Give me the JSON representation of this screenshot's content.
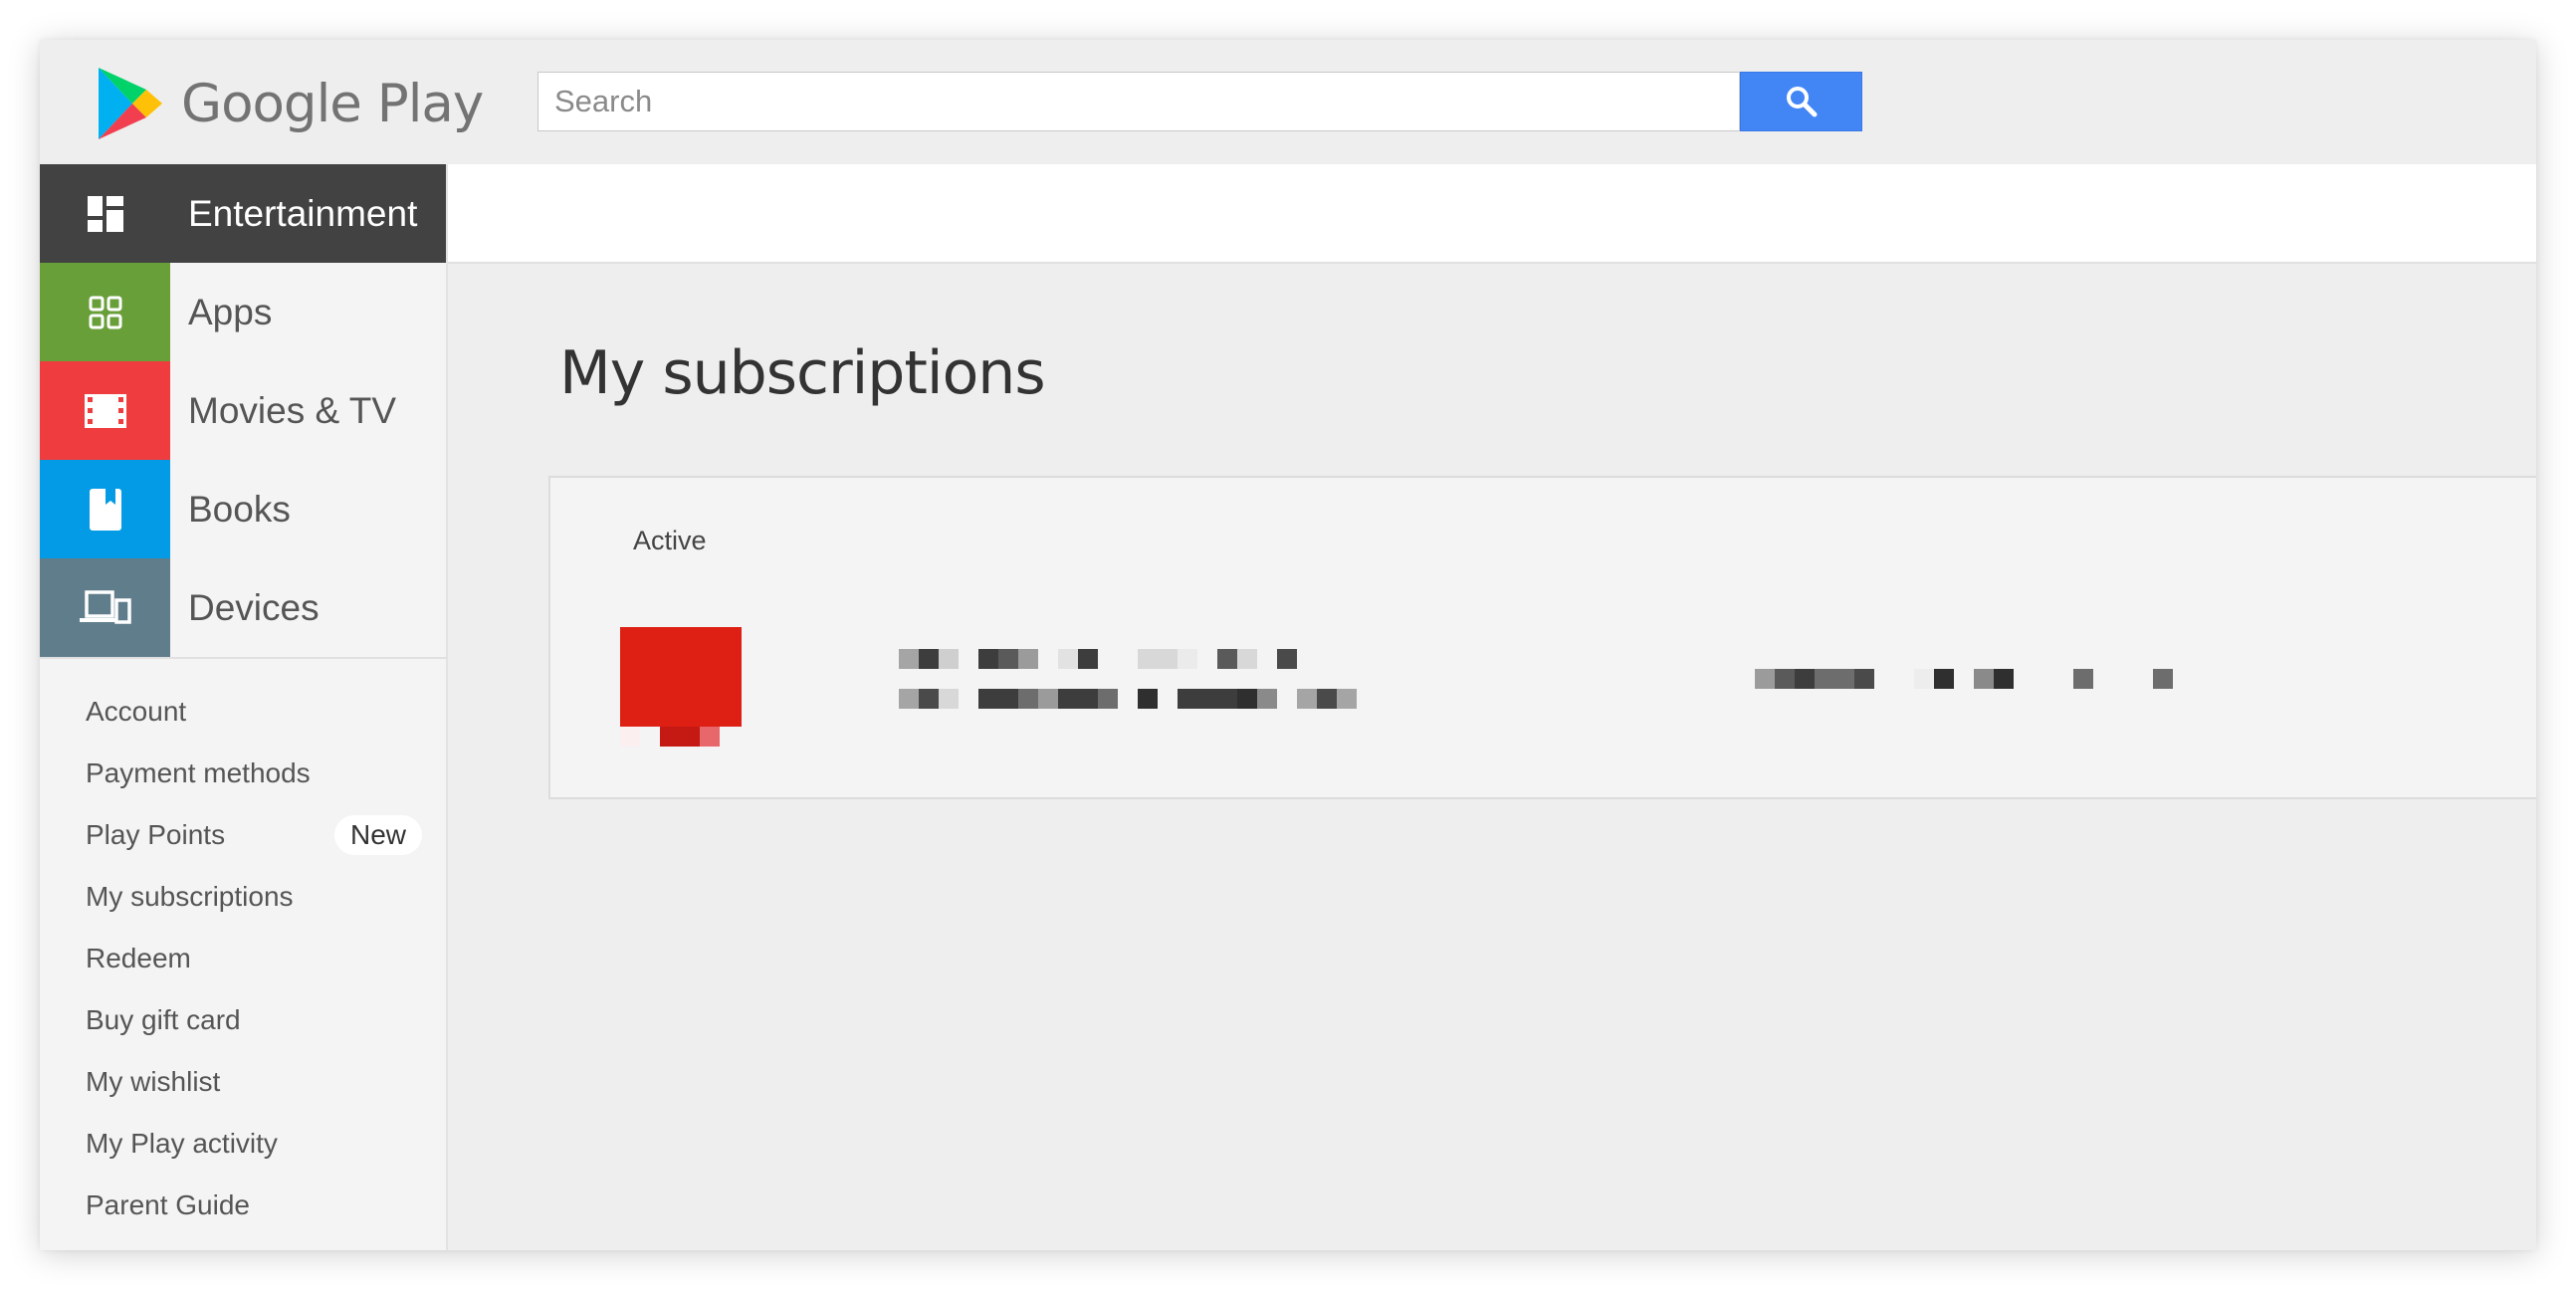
{
  "header": {
    "brand": "Google Play",
    "search": {
      "placeholder": "Search",
      "value": ""
    },
    "search_button_icon": "search-icon"
  },
  "sidebar": {
    "categories": [
      {
        "label": "Entertainment",
        "icon": "entertainment-icon",
        "color": "#424242",
        "selected": true
      },
      {
        "label": "Apps",
        "icon": "apps-grid-icon",
        "color": "#689f38"
      },
      {
        "label": "Movies & TV",
        "icon": "film-icon",
        "color": "#ef3d3f"
      },
      {
        "label": "Books",
        "icon": "book-icon",
        "color": "#039be5"
      },
      {
        "label": "Devices",
        "icon": "devices-icon",
        "color": "#607d8b"
      }
    ],
    "links": [
      {
        "label": "Account"
      },
      {
        "label": "Payment methods"
      },
      {
        "label": "Play Points",
        "badge": "New"
      },
      {
        "label": "My subscriptions"
      },
      {
        "label": "Redeem"
      },
      {
        "label": "Buy gift card"
      },
      {
        "label": "My wishlist"
      },
      {
        "label": "My Play activity"
      },
      {
        "label": "Parent Guide"
      }
    ]
  },
  "main": {
    "title": "My subscriptions",
    "section_label": "Active"
  },
  "colors": {
    "accent_blue": "#4285f4",
    "thumbnail_red": "#dd1f14"
  }
}
